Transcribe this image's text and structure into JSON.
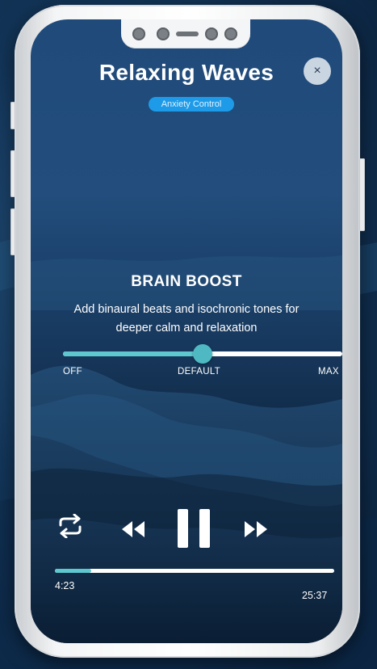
{
  "header": {
    "title": "Relaxing Waves",
    "badge": "Anxiety Control",
    "close_icon": "close-icon",
    "close_glyph": "×"
  },
  "brain_boost": {
    "title": "BRAIN BOOST",
    "description": "Add binaural beats and isochronic tones for deeper calm and relaxation",
    "slider": {
      "value_fraction": 0.5,
      "labels": {
        "off": "OFF",
        "default": "DEFAULT",
        "max": "MAX"
      }
    }
  },
  "player": {
    "controls": [
      "repeat-icon",
      "rewind-icon",
      "pause-icon",
      "fast-forward-icon"
    ],
    "progress_fraction": 0.13,
    "elapsed": "4:23",
    "total": "25:37"
  },
  "colors": {
    "accent": "#5fc8cf",
    "badge": "#1e9be8",
    "screen_top": "#1f4a7a",
    "screen_bottom": "#0b2038"
  }
}
